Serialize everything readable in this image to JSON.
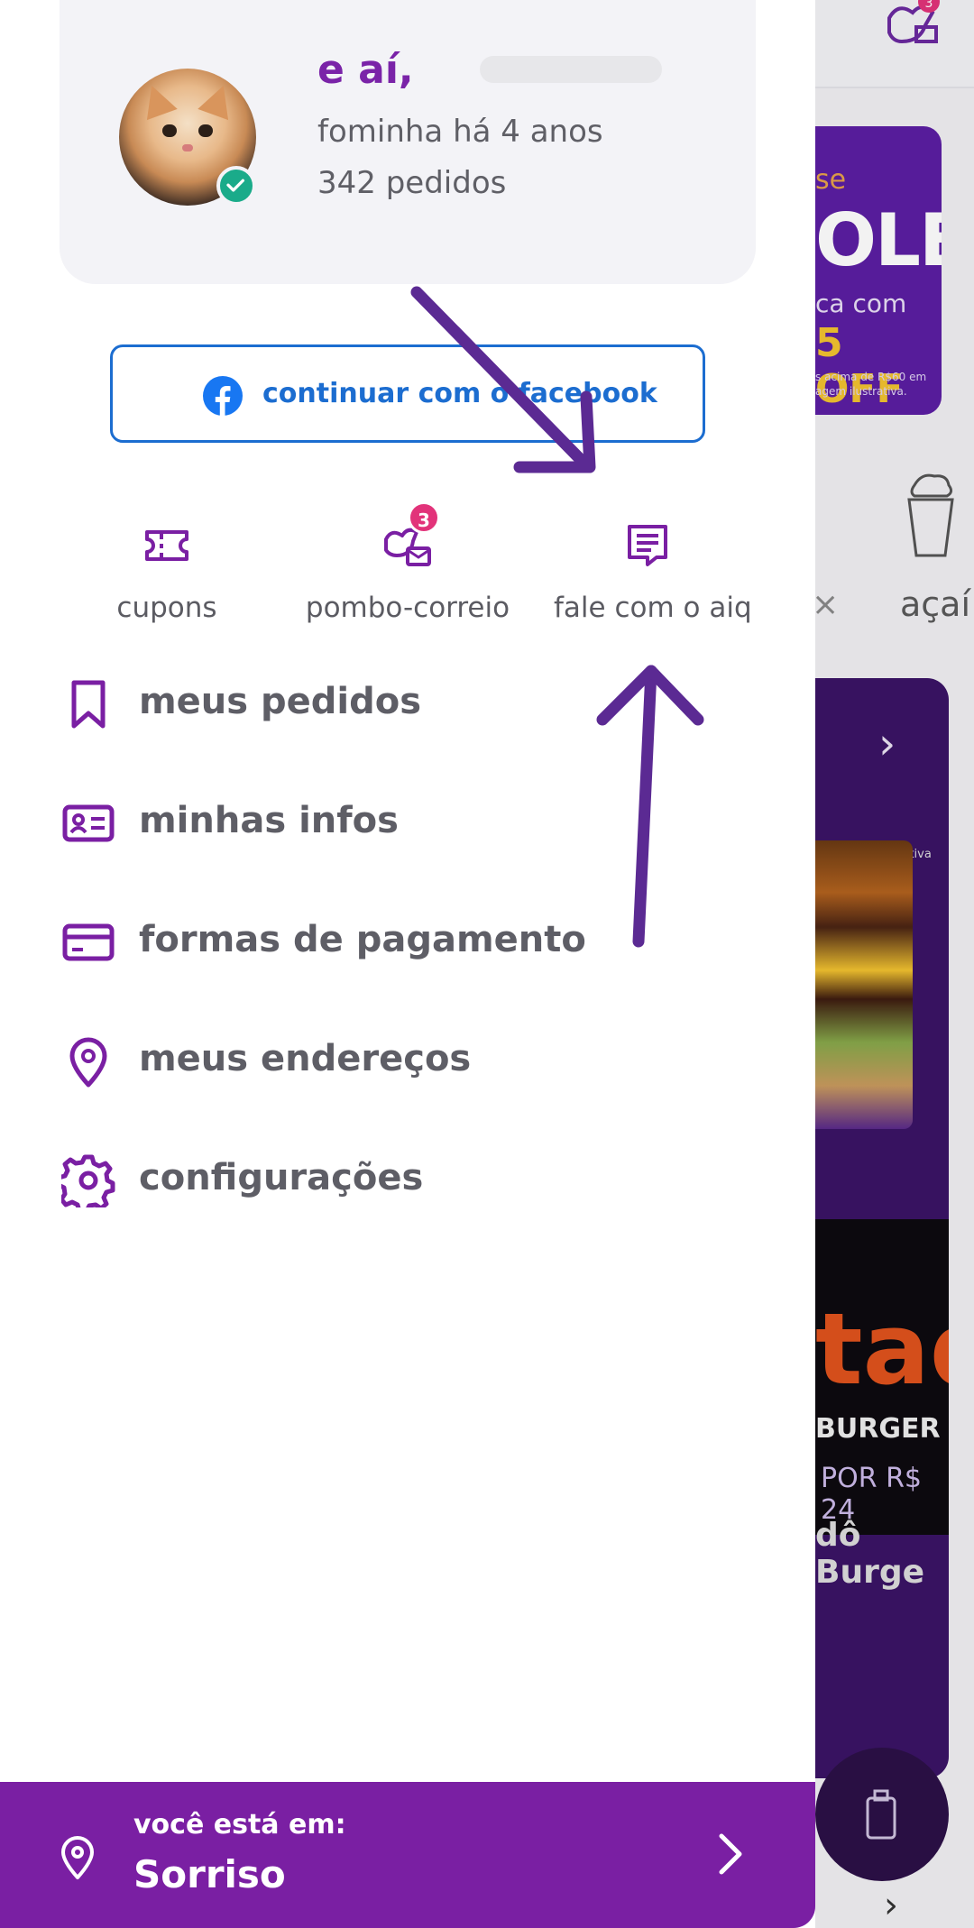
{
  "background": {
    "banner": {
      "line1": "se",
      "line2": "OLE",
      "line3": "ca com",
      "line4": "5 OFF",
      "fine_print": "s acima de R$60 em\nagem ilustrativa."
    },
    "category_close": "×",
    "category_label": "açaí",
    "card": {
      "image_note": "*imagem ilustrativa",
      "logo_text": "tado",
      "logo_sub": "BURGER",
      "price": "POR R$ 24",
      "name": "dô Burge"
    },
    "notification_badge": "3"
  },
  "profile": {
    "greeting": "e aí,",
    "member_since": "fominha há 4 anos",
    "orders": "342 pedidos"
  },
  "facebook_button": {
    "label": "continuar com o facebook"
  },
  "quick_actions": [
    {
      "label": "cupons",
      "icon": "ticket-icon"
    },
    {
      "label": "pombo-correio",
      "icon": "bird-mail-icon",
      "badge": "3"
    },
    {
      "label": "fale com o aiq",
      "icon": "chat-icon"
    }
  ],
  "menu": [
    {
      "label": "meus pedidos",
      "icon": "bookmark-icon"
    },
    {
      "label": "minhas infos",
      "icon": "id-card-icon"
    },
    {
      "label": "formas de pagamento",
      "icon": "credit-card-icon"
    },
    {
      "label": "meus endereços",
      "icon": "location-pin-icon"
    },
    {
      "label": "configurações",
      "icon": "gear-icon"
    }
  ],
  "location": {
    "caption": "você está em:",
    "city": "Sorriso"
  },
  "colors": {
    "brand_purple": "#7a1fa3",
    "facebook_blue": "#1c6dd0",
    "badge_pink": "#e2337a",
    "verified_green": "#1aab8a",
    "annotation_arrow": "#5b2a93"
  }
}
